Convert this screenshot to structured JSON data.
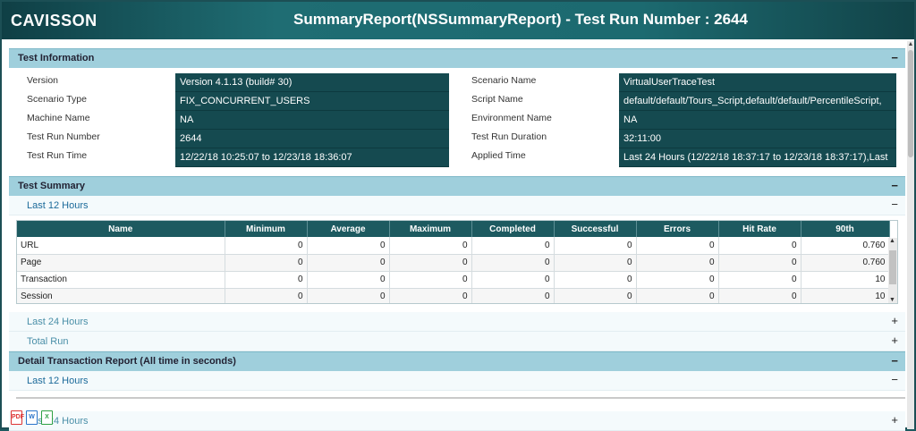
{
  "header": {
    "logo": "CAVISSON",
    "title": "SummaryReport(NSSummaryReport) - Test Run Number : 2644"
  },
  "test_information": {
    "title": "Test Information",
    "toggle": "−",
    "left": [
      {
        "label": "Version",
        "value": "Version 4.1.13 (build# 30)"
      },
      {
        "label": "Scenario Type",
        "value": "FIX_CONCURRENT_USERS"
      },
      {
        "label": "Machine Name",
        "value": "NA"
      },
      {
        "label": "Test Run Number",
        "value": "2644"
      },
      {
        "label": "Test Run Time",
        "value": "12/22/18  10:25:07 to 12/23/18 18:36:07"
      }
    ],
    "right": [
      {
        "label": "Scenario Name",
        "value": "VirtualUserTraceTest"
      },
      {
        "label": "Script Name",
        "value": "default/default/Tours_Script,default/default/PercentileScript,"
      },
      {
        "label": "Environment Name",
        "value": "NA"
      },
      {
        "label": "Test Run Duration",
        "value": "32:11:00"
      },
      {
        "label": "Applied Time",
        "value": "Last 24 Hours (12/22/18 18:37:17 to 12/23/18 18:37:17),Last"
      }
    ]
  },
  "test_summary": {
    "title": "Test Summary",
    "toggle": "−",
    "last12": {
      "label": "Last 12 Hours",
      "toggle": "−"
    },
    "last24": {
      "label": "Last 24 Hours",
      "toggle": "+"
    },
    "total": {
      "label": "Total Run",
      "toggle": "+"
    },
    "columns": [
      "Name",
      "Minimum",
      "Average",
      "Maximum",
      "Completed",
      "Successful",
      "Errors",
      "Hit Rate",
      "90th"
    ],
    "rows": [
      [
        "URL",
        "0",
        "0",
        "0",
        "0",
        "0",
        "0",
        "0",
        "0.760"
      ],
      [
        "Page",
        "0",
        "0",
        "0",
        "0",
        "0",
        "0",
        "0",
        "0.760"
      ],
      [
        "Transaction",
        "0",
        "0",
        "0",
        "0",
        "0",
        "0",
        "0",
        "10"
      ],
      [
        "Session",
        "0",
        "0",
        "0",
        "0",
        "0",
        "0",
        "0",
        "10"
      ]
    ]
  },
  "detail_transaction": {
    "title": "Detail Transaction Report (All time in seconds)",
    "toggle": "−",
    "last12": {
      "label": "Last 12 Hours",
      "toggle": "−"
    },
    "last24": {
      "label": "Last 24 Hours",
      "toggle": "+"
    }
  },
  "export": {
    "pdf": "PDF",
    "word": "W",
    "excel": "X"
  }
}
